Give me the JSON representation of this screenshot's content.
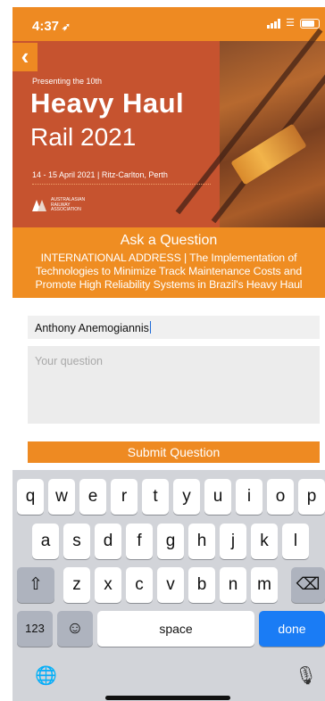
{
  "status_bar": {
    "time": "4:37",
    "location_glyph": "➶"
  },
  "back_icon": "chevron-left-icon",
  "banner": {
    "presenting": "Presenting the 10th",
    "title": "Heavy Haul",
    "subtitle": "Rail 2021",
    "dates": "14 - 15 April 2021  |  Ritz-Carlton, Perth",
    "association": "AUSTRALASIAN RAILWAY ASSOCIATION"
  },
  "ask": {
    "heading": "Ask a Question",
    "desc_line1": "INTERNATIONAL ADDRESS | The Implementation of",
    "desc_line2": "Technologies to Minimize Track Maintenance Costs and",
    "desc_line3": "Promote High Reliability Systems in Brazil's Heavy Haul"
  },
  "form": {
    "name_value": "Anthony Anemogiannis",
    "question_placeholder": "Your question",
    "submit_label": "Submit Question"
  },
  "keyboard": {
    "row1": [
      "q",
      "w",
      "e",
      "r",
      "t",
      "y",
      "u",
      "i",
      "o",
      "p"
    ],
    "row2": [
      "a",
      "s",
      "d",
      "f",
      "g",
      "h",
      "j",
      "k",
      "l"
    ],
    "row3": [
      "z",
      "x",
      "c",
      "v",
      "b",
      "n",
      "m"
    ],
    "shift": "⇧",
    "delete": "⌫",
    "numbers": "123",
    "emoji": "☺",
    "space": "space",
    "done": "done",
    "globe": "🌐",
    "mic": "🎙"
  },
  "colors": {
    "accent": "#ee8a22",
    "banner": "#c6532f",
    "done": "#1a7cf5"
  }
}
